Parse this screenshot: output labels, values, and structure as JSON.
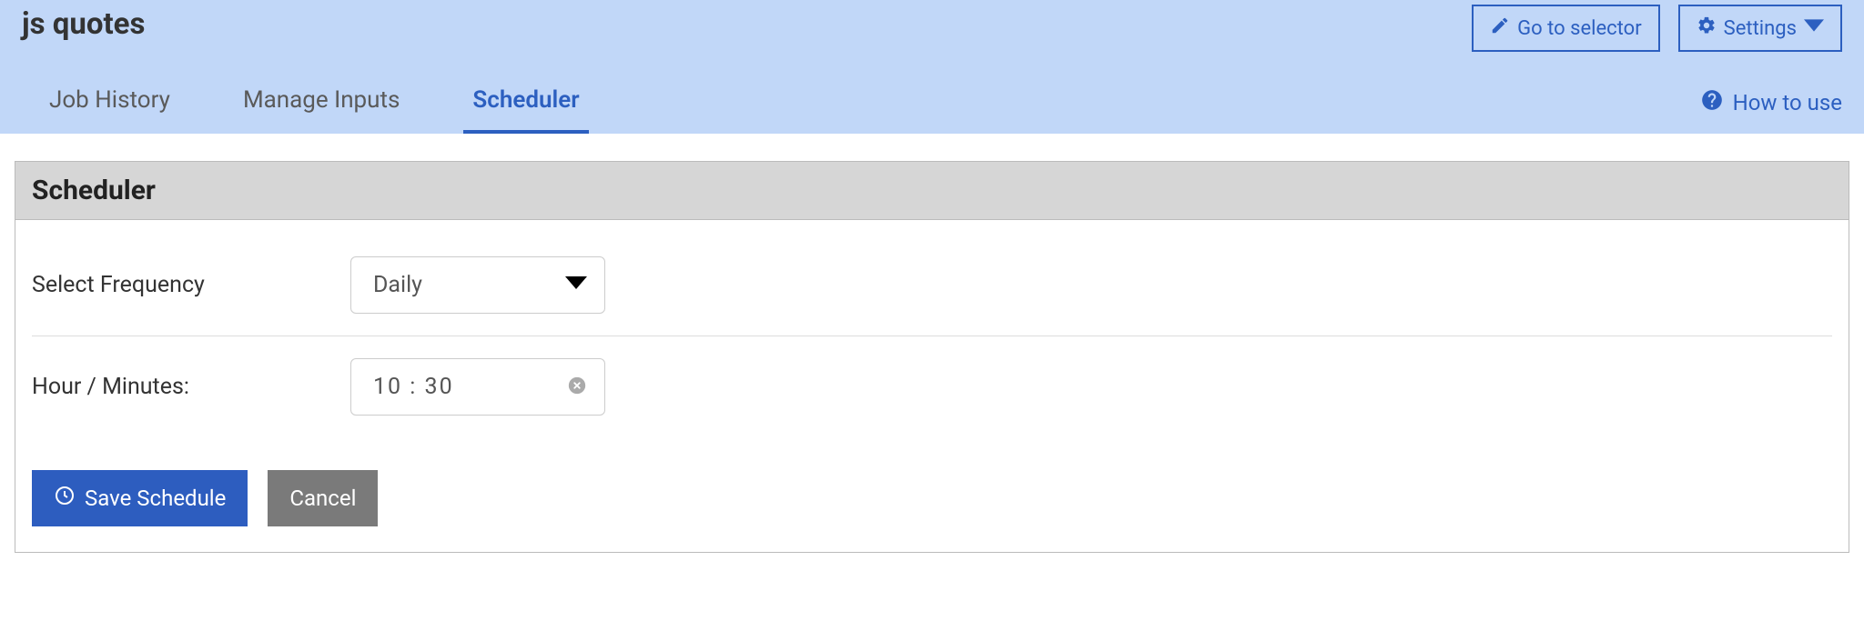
{
  "header": {
    "title": "js quotes",
    "go_to_selector_label": "Go to selector",
    "settings_label": "Settings"
  },
  "tabs": {
    "items": [
      {
        "label": "Job History",
        "active": false
      },
      {
        "label": "Manage Inputs",
        "active": false
      },
      {
        "label": "Scheduler",
        "active": true
      }
    ],
    "how_to_use_label": "How to use"
  },
  "panel": {
    "title": "Scheduler",
    "frequency": {
      "label": "Select Frequency",
      "value": "Daily"
    },
    "time": {
      "label": "Hour / Minutes:",
      "value": "10 : 30"
    },
    "buttons": {
      "save": "Save Schedule",
      "cancel": "Cancel"
    }
  }
}
